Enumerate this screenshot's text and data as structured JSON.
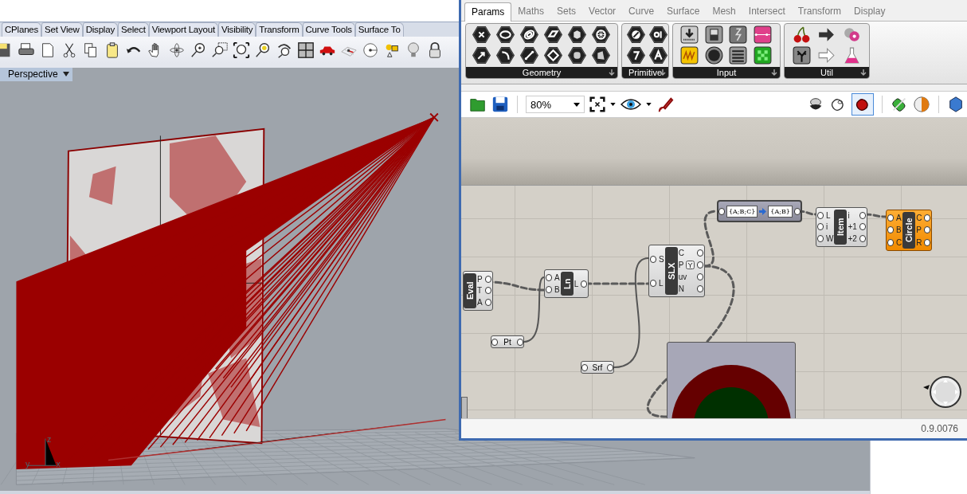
{
  "rhino": {
    "tabs": [
      "CPlanes",
      "Set View",
      "Display",
      "Select",
      "Viewport Layout",
      "Visibility",
      "Transform",
      "Curve Tools",
      "Surface To"
    ],
    "viewport": {
      "title": "Perspective",
      "axis_labels": [
        "z",
        "y",
        "x"
      ]
    }
  },
  "grasshopper": {
    "tabs": [
      {
        "label": "Params",
        "selected": true
      },
      {
        "label": "Maths",
        "selected": false
      },
      {
        "label": "Sets",
        "selected": false
      },
      {
        "label": "Vector",
        "selected": false
      },
      {
        "label": "Curve",
        "selected": false
      },
      {
        "label": "Surface",
        "selected": false
      },
      {
        "label": "Mesh",
        "selected": false
      },
      {
        "label": "Intersect",
        "selected": false
      },
      {
        "label": "Transform",
        "selected": false
      },
      {
        "label": "Display",
        "selected": false
      }
    ],
    "ribbon_groups": [
      "Geometry",
      "Primitive",
      "Input",
      "Util"
    ],
    "zoom": "80%",
    "nodes": [
      {
        "kind": "component",
        "name": "Eval",
        "outputs": [
          "P",
          "T",
          "A"
        ],
        "selected": false,
        "flagged": false
      },
      {
        "kind": "component",
        "name": "Ln",
        "inputs": [
          "A",
          "B"
        ],
        "outputs": [
          "L"
        ],
        "selected": false,
        "flagged": false
      },
      {
        "kind": "component",
        "name": "SLX",
        "inputs": [
          "S",
          "L"
        ],
        "outputs": [
          "C",
          "P",
          "uv",
          "N"
        ],
        "selected": false,
        "flagged": true
      },
      {
        "kind": "shift",
        "from": "{A;B;C}",
        "to": "{A;B}"
      },
      {
        "kind": "component",
        "name": "Item",
        "inputs": [
          "L",
          "i",
          "W"
        ],
        "outputs": [
          "i",
          "+1",
          "+2"
        ],
        "selected": false,
        "flagged": false
      },
      {
        "kind": "component",
        "name": "Circle",
        "inputs": [
          "A",
          "B",
          "C"
        ],
        "outputs": [
          "C",
          "P",
          "R"
        ],
        "selected": true,
        "flagged": false
      },
      {
        "kind": "param",
        "name": "Pt"
      },
      {
        "kind": "param",
        "name": "Srf"
      },
      {
        "kind": "preview"
      }
    ],
    "version": "0.9.0076"
  }
}
